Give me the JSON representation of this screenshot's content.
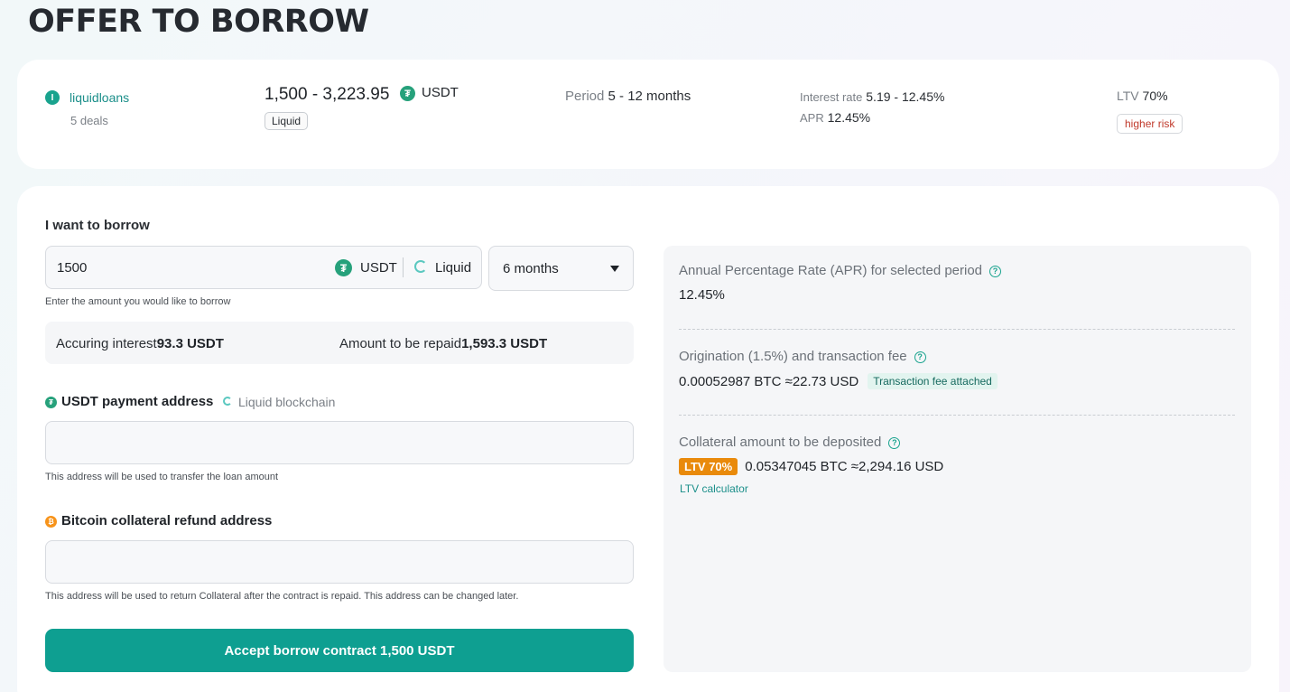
{
  "page": {
    "title": "OFFER TO BORROW"
  },
  "offer": {
    "lender_icon": "I",
    "lender_name": "liquidloans",
    "deals": "5 deals",
    "amount_range": "1,500 - 3,223.95",
    "currency": "USDT",
    "currency_icon": "usdt-icon",
    "network_tag": "Liquid",
    "period_label": "Period",
    "period_value": "5 - 12 months",
    "interest_label": "Interest rate",
    "interest_value": "5.19 - 12.45%",
    "apr_label": "APR",
    "apr_value": "12.45%",
    "ltv_label": "LTV",
    "ltv_value": "70%",
    "risk_tag": "higher risk"
  },
  "form": {
    "section_label": "I want to borrow",
    "amount_value": "1500",
    "currency": "USDT",
    "network": "Liquid",
    "period_selected": "6 months",
    "amount_hint": "Enter the amount you would like to borrow",
    "accruing_label": "Accuring interest",
    "accruing_value": "93.3 USDT",
    "repay_label": "Amount to be repaid",
    "repay_value": "1,593.3 USDT",
    "usdt_address_label": "USDT payment address",
    "usdt_chain": "Liquid blockchain",
    "usdt_address_value": "",
    "usdt_address_hint": "This address will be used to transfer the loan amount",
    "btc_address_label": "Bitcoin collateral refund address",
    "btc_address_value": "",
    "btc_address_hint": "This address will be used to return Collateral after the contract is repaid. This address can be changed later.",
    "submit_label": "Accept borrow contract 1,500 USDT"
  },
  "details": {
    "apr_label": "Annual Percentage Rate (APR) for selected period",
    "apr_value": "12.45%",
    "fee_label": "Origination (1.5%) and transaction fee",
    "fee_value": "0.00052987 BTC ≈22.73 USD",
    "fee_badge": "Transaction fee attached",
    "collateral_label": "Collateral amount to be deposited",
    "ltv_badge": "LTV 70%",
    "collateral_value": "0.05347045 BTC ≈2,294.16 USD",
    "ltv_calculator": "LTV calculator",
    "help_glyph": "?"
  },
  "icons": {
    "usdt_glyph": "₮",
    "btc_glyph": "₿"
  },
  "colors": {
    "accent": "#0e9f91",
    "usdt": "#26a17b",
    "btc": "#f7931a",
    "ltv_badge": "#e98a0b",
    "risk": "#c0392b"
  }
}
